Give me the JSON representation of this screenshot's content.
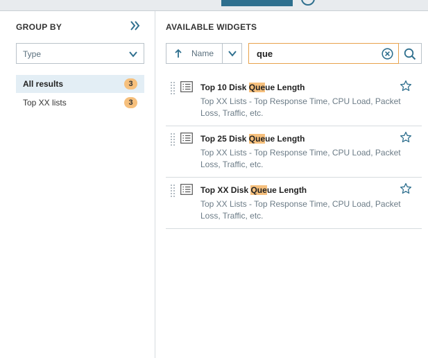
{
  "left_panel": {
    "title": "GROUP BY",
    "type_select": {
      "value": "Type"
    },
    "groups": [
      {
        "label": "All results",
        "count": "3",
        "active": true
      },
      {
        "label": "Top XX lists",
        "count": "3",
        "active": false
      }
    ]
  },
  "right_panel": {
    "title": "AVAILABLE WIDGETS",
    "sort": {
      "label": "Name"
    },
    "search": {
      "value": "que"
    },
    "widgets": [
      {
        "title_pre": "Top 10 Disk ",
        "title_hl": "Que",
        "title_post": "ue Length",
        "description": "Top XX Lists - Top Response Time, CPU Load, Packet Loss, Traffic, etc."
      },
      {
        "title_pre": "Top 25 Disk ",
        "title_hl": "Que",
        "title_post": "ue Length",
        "description": "Top XX Lists - Top Response Time, CPU Load, Packet Loss, Traffic, etc."
      },
      {
        "title_pre": "Top XX Disk ",
        "title_hl": "Que",
        "title_post": "ue Length",
        "description": "Top XX Lists - Top Response Time, CPU Load, Packet Loss, Traffic, etc."
      }
    ]
  },
  "colors": {
    "accent": "#2e6f8e",
    "highlight": "#f6c07d",
    "search_border": "#e8a24b"
  },
  "icons": [
    "double-chevron-right-icon",
    "chevron-down-icon",
    "arrow-up-icon",
    "clear-circle-icon",
    "search-icon",
    "drag-handle-icon",
    "list-icon",
    "star-icon"
  ]
}
